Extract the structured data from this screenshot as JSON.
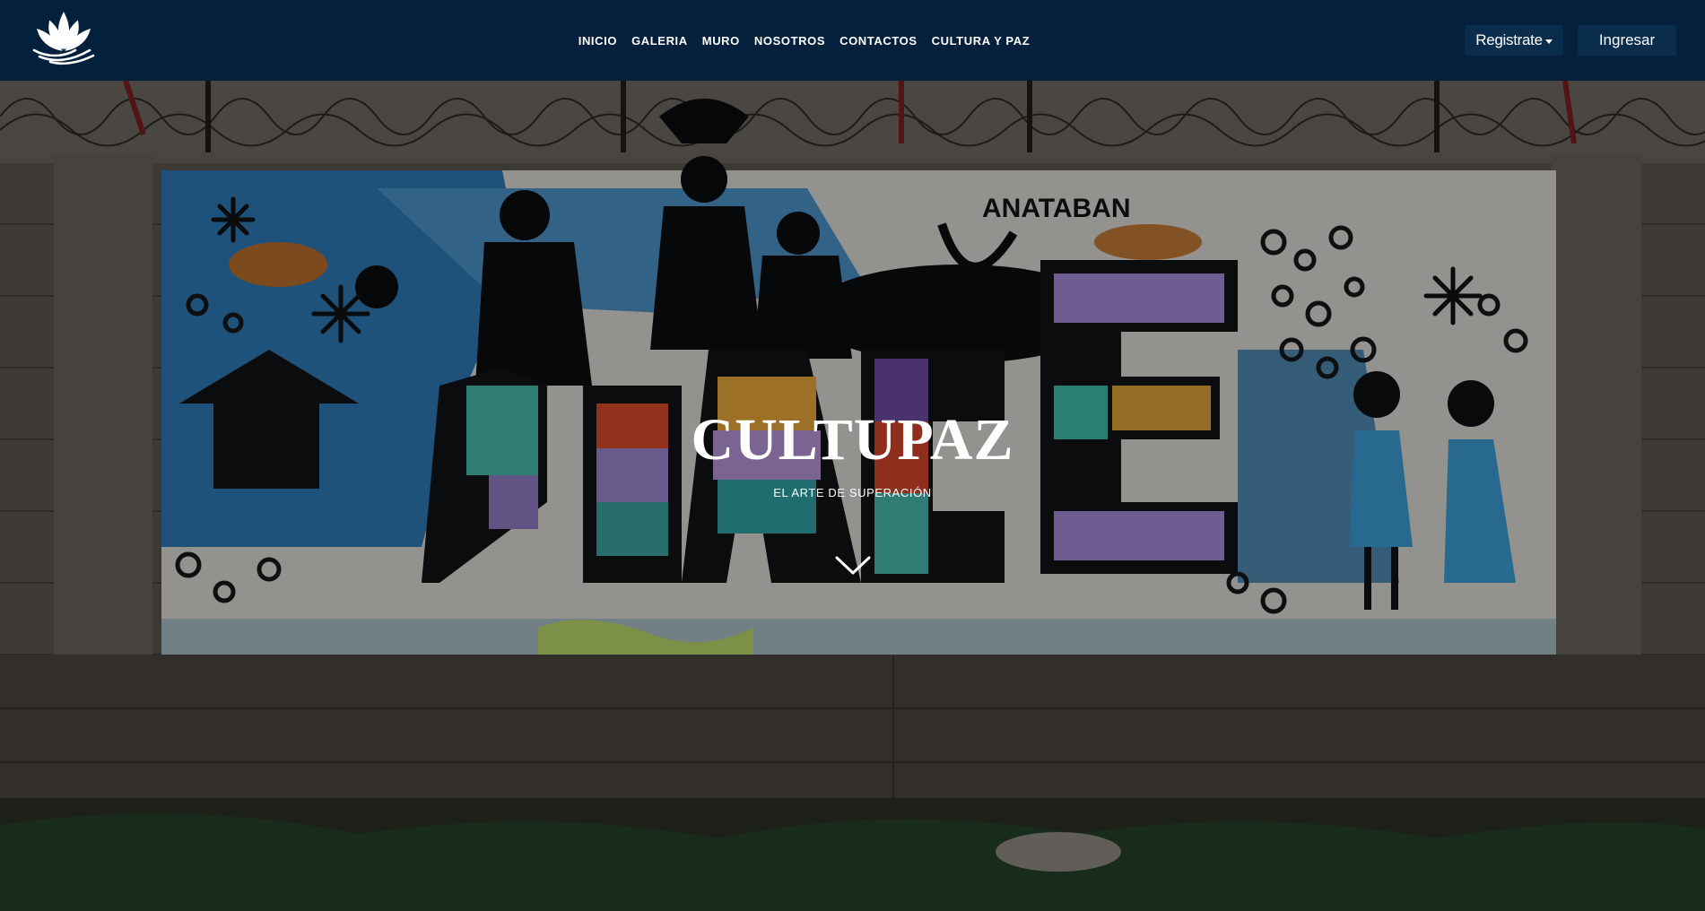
{
  "nav": {
    "logo_icon": "lotus-logo-icon",
    "links": [
      "INICIO",
      "GALERIA",
      "MURO",
      "NOSOTROS",
      "CONTACTOS",
      "CULTURA Y PAZ"
    ],
    "register_label": "Registrate",
    "login_label": "Ingresar",
    "background_color": "#04203c",
    "button_color": "#0a2d4d"
  },
  "hero": {
    "title": "CULTUPAZ",
    "subtitle": "EL ARTE DE SUPERACIÓN",
    "scroll_icon": "chevron-down-icon",
    "mural_text": "ANATABAN",
    "mural_word": "PEACE"
  }
}
